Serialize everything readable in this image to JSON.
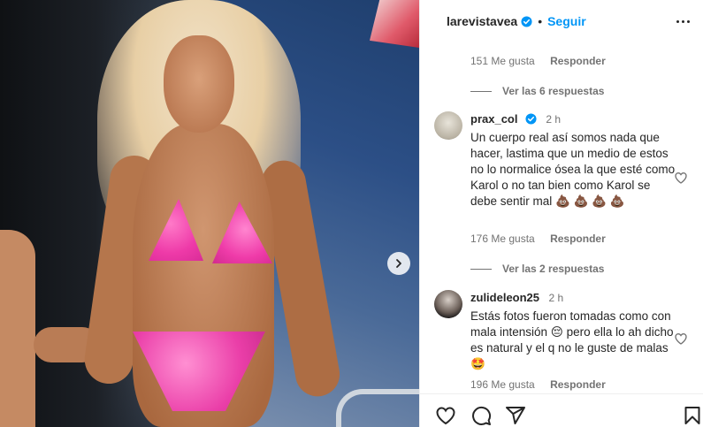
{
  "post": {
    "author": "larevistavea",
    "follow_label": "Seguir",
    "separator": "•"
  },
  "thread": {
    "top_meta": {
      "likes": "151 Me gusta",
      "reply": "Responder"
    },
    "view_replies_1": "Ver las 6 respuestas",
    "view_replies_2": "Ver las 2 respuestas",
    "comments": [
      {
        "username": "prax_col",
        "verified": true,
        "time": "2 h",
        "text": "Un cuerpo real así somos nada que hacer, lastima que un medio de estos no lo normalice ósea la que esté como Karol o no tan bien como Karol se debe sentir mal 💩 💩 💩 💩",
        "likes": "176 Me gusta",
        "reply": "Responder"
      },
      {
        "username": "zulideleon25",
        "verified": false,
        "time": "2 h",
        "text": "Estás fotos fueron tomadas como con mala intensión 😔 pero ella lo ah dicho es natural y el q no le guste de malas 🤩",
        "likes": "196 Me gusta",
        "reply": "Responder"
      }
    ]
  },
  "icons": {
    "more": "more-options-icon",
    "next": "chevron-right-icon",
    "like": "heart-icon",
    "comment": "comment-icon",
    "share": "share-icon",
    "save": "bookmark-icon",
    "verified": "verified-badge-icon"
  },
  "colors": {
    "accent": "#0095f6",
    "text": "#262626",
    "muted": "#737373",
    "bikini": "#ee3aa8"
  }
}
